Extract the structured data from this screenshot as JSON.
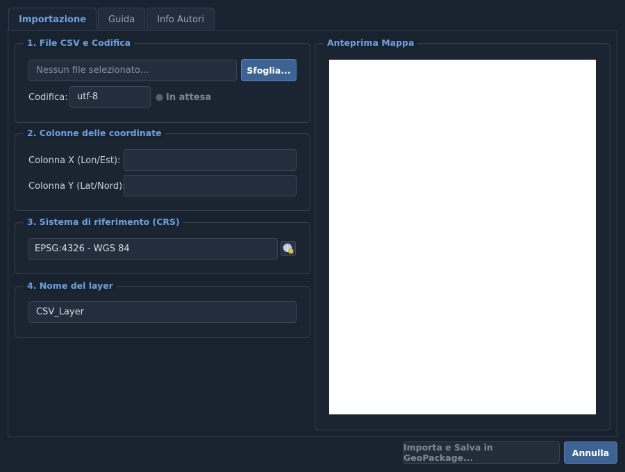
{
  "tabs": [
    {
      "label": "Importazione",
      "active": true
    },
    {
      "label": "Guida",
      "active": false
    },
    {
      "label": "Info Autori",
      "active": false
    }
  ],
  "csv_group": {
    "title": "1. File CSV e Codifica",
    "file_placeholder": "Nessun file selezionato...",
    "browse_label": "Sfoglia...",
    "encoding_label": "Codifica:",
    "encoding_value": "utf-8",
    "status_text": "In attesa"
  },
  "coords_group": {
    "title": "2. Colonne delle coordinate",
    "x_label": "Colonna X (Lon/Est):",
    "x_value": "",
    "y_label": "Colonna Y (Lat/Nord):",
    "y_value": ""
  },
  "crs_group": {
    "title": "3. Sistema di riferimento (CRS)",
    "crs_value": "EPSG:4326 - WGS 84",
    "crs_icon": "globe-select-icon"
  },
  "layer_group": {
    "title": "4. Nome del layer",
    "layer_value": "CSV_Layer"
  },
  "preview_group": {
    "title": "Anteprima Mappa"
  },
  "footer": {
    "import_label": "Importa e Salva in GeoPackage...",
    "cancel_label": "Annulla"
  },
  "colors": {
    "accent": "#6fa0dc",
    "background": "#19222f",
    "primary_button": "#3d6394"
  }
}
